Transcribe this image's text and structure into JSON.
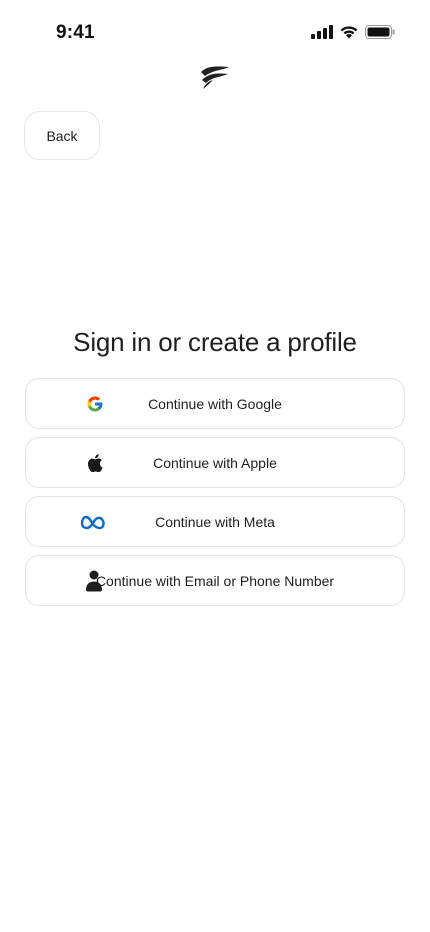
{
  "status_bar": {
    "time": "9:41",
    "icons": [
      "signal-icon",
      "wifi-icon",
      "battery-icon"
    ]
  },
  "header": {
    "logo": "app-logo-icon",
    "back_label": "Back"
  },
  "main": {
    "title": "Sign in or create a profile",
    "auth_options": [
      {
        "label": "Continue with Google",
        "icon": "google-icon"
      },
      {
        "label": "Continue with Apple",
        "icon": "apple-icon"
      },
      {
        "label": "Continue with Meta",
        "icon": "meta-icon"
      },
      {
        "label": "Continue with Email or Phone Number",
        "icon": "person-icon"
      }
    ]
  },
  "colors": {
    "text": "#1f1f1f",
    "border": "#e3e3e3",
    "meta_blue": "#0a6bd8"
  }
}
